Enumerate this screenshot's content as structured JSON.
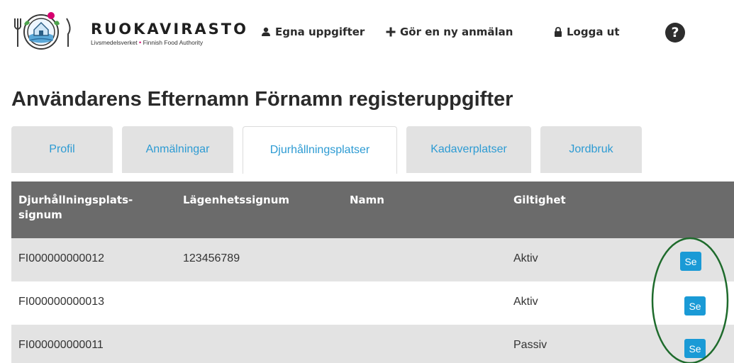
{
  "header": {
    "logo": {
      "name": "RUOKAVIRASTO",
      "sub_left": "Livsmedelsverket",
      "sub_dot": "•",
      "sub_right": "Finnish Food Authority"
    },
    "nav": [
      {
        "label": "Egna uppgifter",
        "icon": "user-icon"
      },
      {
        "label": "Gör en ny anmälan",
        "icon": "plus-icon"
      },
      {
        "label": "Logga ut",
        "icon": "lock-icon"
      }
    ],
    "help_icon": "?"
  },
  "page": {
    "title": "Användarens Efternamn Förnamn registeruppgifter"
  },
  "tabs": [
    {
      "label": "Profil",
      "active": false
    },
    {
      "label": "Anmälningar",
      "active": false
    },
    {
      "label": "Djurhållningsplatser",
      "active": true
    },
    {
      "label": "Kadaverplatser",
      "active": false
    },
    {
      "label": "Jordbruk",
      "active": false
    }
  ],
  "table": {
    "headers": {
      "signum_line1": "Djurhållningsplats-",
      "signum_line2": "signum",
      "lagenhet": "Lägenhetssignum",
      "namn": "Namn",
      "giltighet": "Giltighet"
    },
    "rows": [
      {
        "signum": "FI000000000012",
        "lagenhet": "123456789",
        "namn": "",
        "giltighet": "Aktiv",
        "action": "Se"
      },
      {
        "signum": "FI000000000013",
        "lagenhet": "",
        "namn": "",
        "giltighet": "Aktiv",
        "action": "Se"
      },
      {
        "signum": "FI000000000011",
        "lagenhet": "",
        "namn": "",
        "giltighet": "Passiv",
        "action": "Se"
      }
    ]
  },
  "colors": {
    "accent": "#1a9ad6",
    "tab_text": "#2d9bd3",
    "table_header": "#6b6b6b",
    "annotation": "#1e6b2c",
    "logo_dot": "#d6006f"
  }
}
